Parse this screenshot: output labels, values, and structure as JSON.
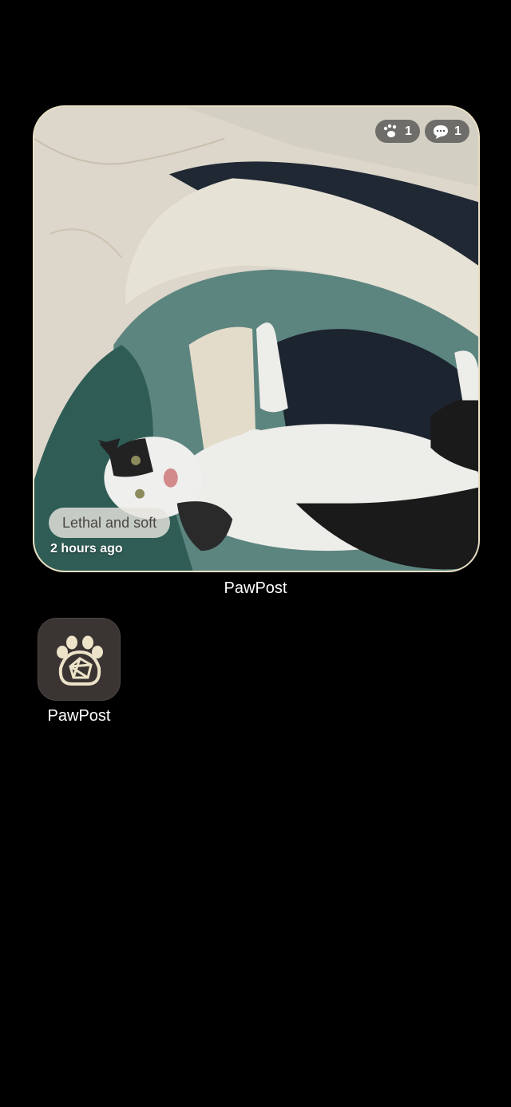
{
  "widget": {
    "caption": "Lethal and soft",
    "timestamp": "2 hours ago",
    "paw_count": "1",
    "comment_count": "1",
    "label": "PawPost",
    "border_color": "#e9dfc4",
    "photo_subject": "black-and-white cat lying on back on teal and cream rug"
  },
  "app": {
    "label": "PawPost",
    "icon": "paw-camera-icon",
    "icon_bg": "#3a3533",
    "icon_fg": "#ede3c8"
  }
}
